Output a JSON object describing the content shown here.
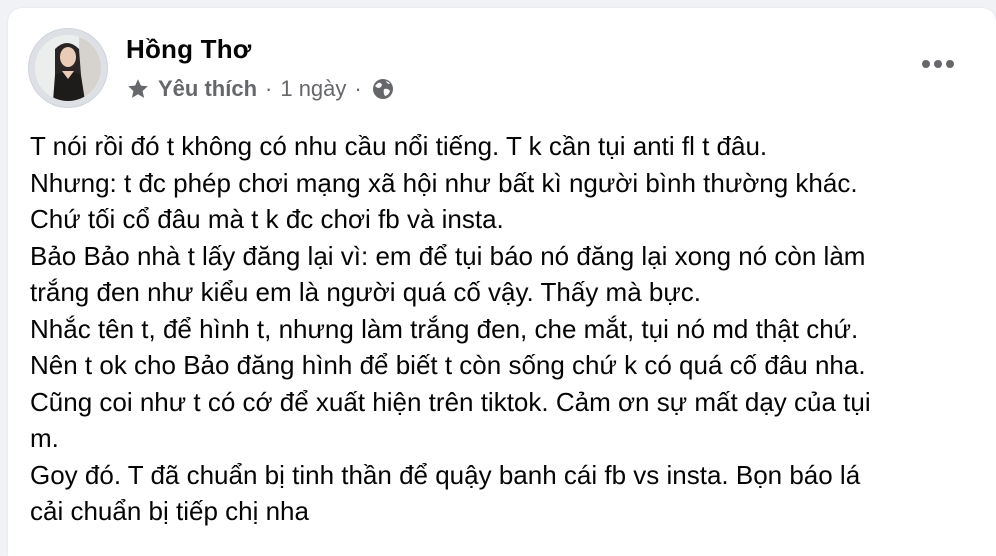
{
  "post": {
    "author_name": "Hồng Thơ",
    "badge_label": "Yêu thích",
    "timestamp": "1 ngày",
    "separator": "·",
    "privacy_icon": "globe-icon",
    "more_icon": "more-options-icon",
    "lines": [
      "T nói rồi đó t không có nhu cầu nổi tiếng. T k cần tụi anti fl t đâu.",
      "Nhưng: t đc phép chơi mạng xã hội như bất kì người bình thường khác.",
      "Chứ tối cổ đâu mà t k đc chơi fb và insta.",
      "Bảo Bảo nhà t lấy đăng lại vì: em để tụi báo nó đăng lại xong nó còn làm",
      "trắng đen như kiểu em là người quá cố vậy. Thấy mà bực.",
      "Nhắc tên t, để hình t, nhưng làm trắng đen, che mắt, tụi nó md thật chứ.",
      "Nên t ok cho Bảo đăng hình để biết t còn sống chứ k có quá cố đâu nha.",
      "Cũng coi như t có cớ để xuất hiện trên tiktok. Cảm ơn sự mất dạy của tụi",
      "m.",
      "Goy đó. T đã chuẩn bị tinh thần để quậy banh cái fb vs insta. Bọn báo lá",
      "cải chuẩn bị tiếp chị nha"
    ]
  },
  "colors": {
    "background": "#f0f2f5",
    "card": "#ffffff",
    "text_primary": "#050505",
    "text_secondary": "#65676b"
  }
}
